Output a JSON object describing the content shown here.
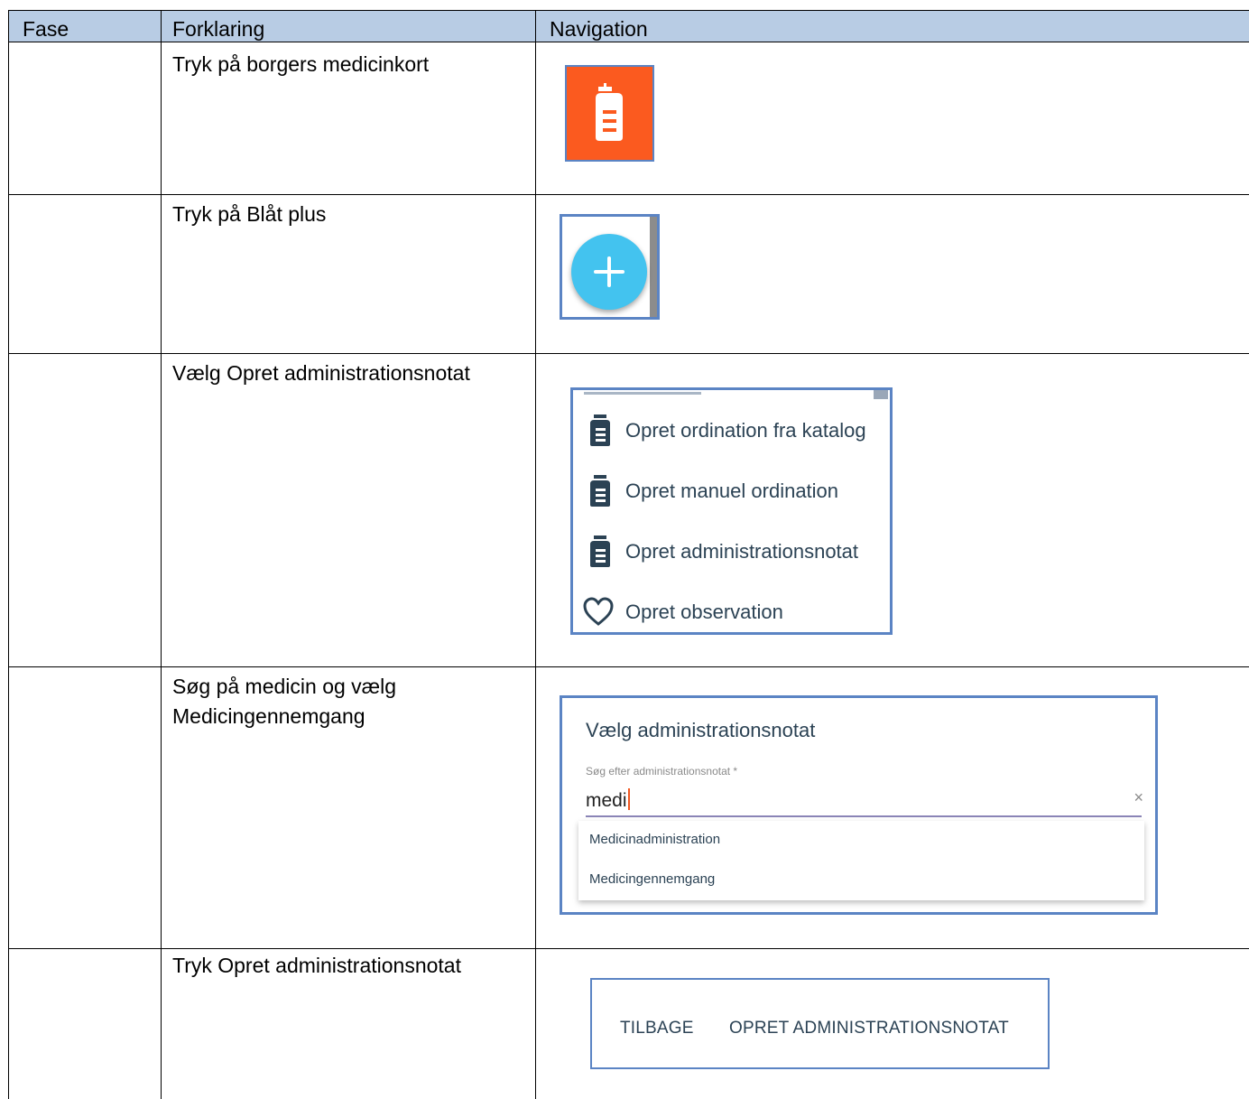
{
  "table": {
    "headers": [
      "Fase",
      "Forklaring",
      "Navigation"
    ],
    "rows": [
      {
        "fase": "",
        "forklaring": "Tryk på borgers medicinkort"
      },
      {
        "fase": "",
        "forklaring": "Tryk på Blåt plus"
      },
      {
        "fase": "",
        "forklaring": "Vælg Opret administrationsnotat"
      },
      {
        "fase": "",
        "forklaring_line1": "Søg på medicin og vælg",
        "forklaring_line2": "Medicingennemgang"
      },
      {
        "fase": "",
        "forklaring": "Tryk Opret administrationsnotat"
      }
    ]
  },
  "menu": {
    "items": [
      {
        "label": "Opret ordination fra katalog",
        "icon": "medicine-bottle-icon"
      },
      {
        "label": "Opret manuel ordination",
        "icon": "medicine-bottle-icon"
      },
      {
        "label": "Opret administrationsnotat",
        "icon": "medicine-bottle-icon"
      },
      {
        "label": "Opret observation",
        "icon": "heart-icon"
      }
    ]
  },
  "search_dialog": {
    "title": "Vælg administrationsnotat",
    "field_label": "Søg efter administrationsnotat *",
    "value": "medi",
    "clear": "×",
    "options": [
      "Medicinadministration",
      "Medicingennemgang"
    ]
  },
  "buttons": {
    "back": "TILBAGE",
    "create": "OPRET ADMINISTRATIONSNOTAT"
  },
  "colors": {
    "header_bg": "#b8cce4",
    "medicine_tile": "#fb5a1f",
    "plus_button": "#43c3ef",
    "snippet_border": "#5b84c4"
  }
}
